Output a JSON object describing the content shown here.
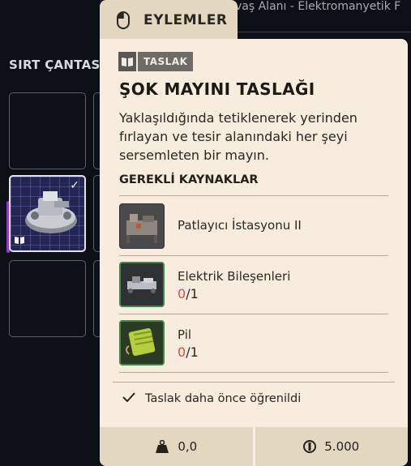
{
  "background": {
    "header_text": "vaş Alanı - Elektromanyetik F",
    "backpack_title": "SIRT ÇANTASI"
  },
  "actions_tab": {
    "label": "EYLEMLER",
    "icon": "mouse-icon"
  },
  "item": {
    "type_label": "TASLAK",
    "type_icon": "book-icon",
    "title": "ŞOK MAYINI TASLAĞI",
    "description": "Yaklaşıldığında tetiklenerek yerinden fırlayan ve tesir alanındaki her şeyi sersemleten bir mayın."
  },
  "requirements": {
    "title": "GEREKLİ KAYNAKLAR",
    "items": [
      {
        "name": "Patlayıcı İstasyonu II",
        "have": "",
        "need": ""
      },
      {
        "name": "Elektrik Bileşenleri",
        "have": "0",
        "need": "/1"
      },
      {
        "name": "Pil",
        "have": "0",
        "need": "/1"
      }
    ]
  },
  "status": {
    "learned_text": "Taslak daha önce öğrenildi"
  },
  "footer": {
    "weight": "0,0",
    "price": "5.000",
    "weight_icon": "weight-icon",
    "currency_icon": "coin-icon"
  },
  "colors": {
    "panel_bg": "#f7ecdd",
    "tab_bg": "#e3d7c0",
    "missing_qty": "#e04a3c",
    "selected_slot": "#232653"
  }
}
